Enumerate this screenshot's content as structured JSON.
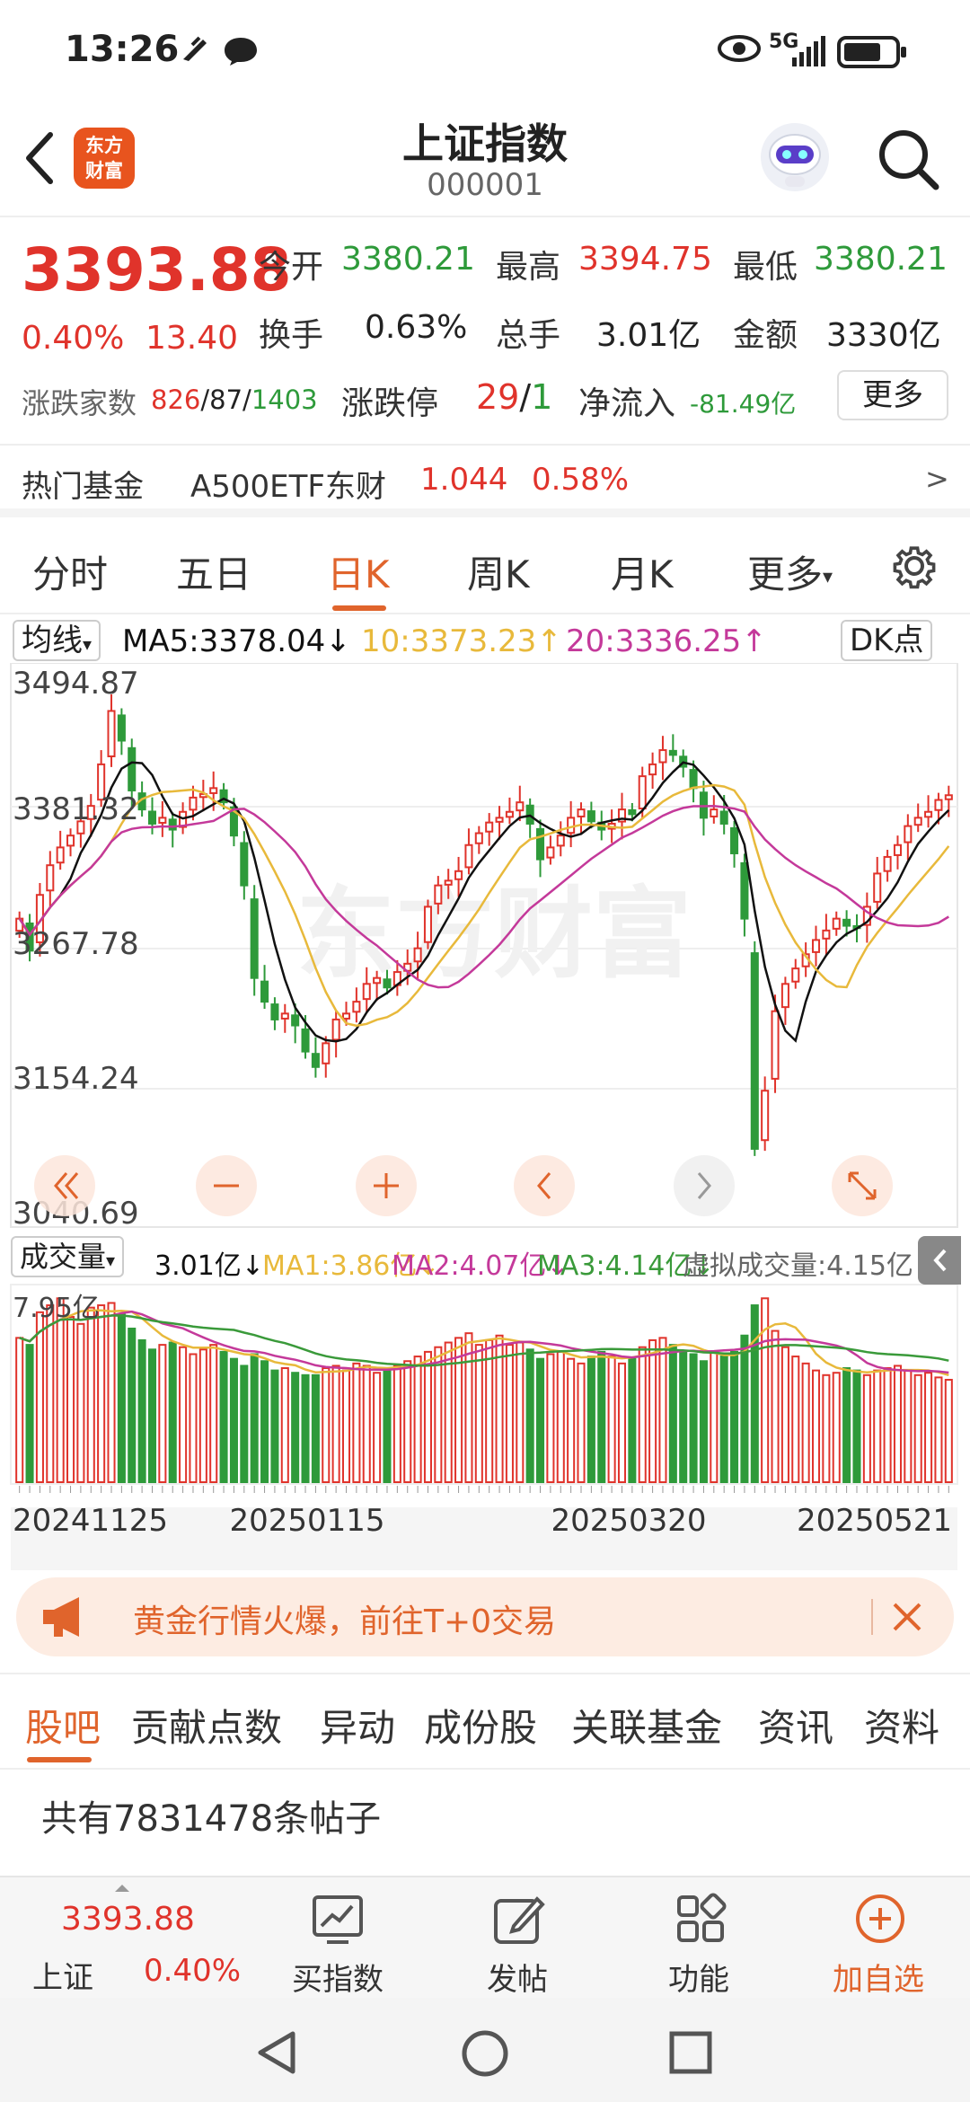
{
  "status_bar": {
    "time": "13:26",
    "network": "5G"
  },
  "header": {
    "title": "上证指数",
    "code": "000001",
    "logo_text_1": "东方",
    "logo_text_2": "财富"
  },
  "quote": {
    "price": "3393.88",
    "change_pct": "0.40%",
    "change_amt": "13.40",
    "open_label": "今开",
    "open": "3380.21",
    "high_label": "最高",
    "high": "3394.75",
    "low_label": "最低",
    "low": "3380.21",
    "turnover_label": "换手",
    "turnover": "0.63%",
    "hands_label": "总手",
    "hands": "3.01亿",
    "amount_label": "金额",
    "amount": "3330亿",
    "updown_label": "涨跌家数",
    "up_count": "826",
    "flat_count": "87",
    "down_count": "1403",
    "limit_label": "涨跌停",
    "limit_up": "29",
    "limit_down": "1",
    "netflow_label": "净流入",
    "netflow": "-81.49亿",
    "more_label": "更多"
  },
  "hot_fund": {
    "label": "热门基金",
    "name": "A500ETF东财",
    "price": "1.044",
    "change": "0.58%",
    "arrow": ">"
  },
  "period_tabs": [
    {
      "label": "分时",
      "active": false
    },
    {
      "label": "五日",
      "active": false
    },
    {
      "label": "日K",
      "active": true
    },
    {
      "label": "周K",
      "active": false
    },
    {
      "label": "月K",
      "active": false
    },
    {
      "label": "更多",
      "active": false
    }
  ],
  "ma_row": {
    "selector": "均线",
    "ma5": "MA5:3378.04",
    "ma10": "10:3373.23",
    "ma20": "20:3336.25",
    "dk_label": "DK点"
  },
  "vol_row": {
    "selector": "成交量",
    "vol": "3.01亿",
    "ma1": "MA1:3.86亿",
    "ma2": "MA2:4.07亿",
    "ma3": "MA3:4.14亿",
    "virtual": "虚拟成交量:4.15亿"
  },
  "colors": {
    "up": "#e0332b",
    "down": "#2e9a3a",
    "accent": "#e0642c",
    "ma5": "#111111",
    "ma10": "#e8b93b",
    "ma20": "#c4399a",
    "vol_ma3": "#3a9a3a"
  },
  "chart_data": {
    "type": "candlestick",
    "y_tick_labels": [
      "3494.87",
      "3381.32",
      "3267.78",
      "3154.24",
      "3040.69"
    ],
    "ylim": [
      3040.69,
      3494.87
    ],
    "x_tick_labels": [
      "20241125",
      "20250115",
      "20250320",
      "20250521"
    ],
    "volume_tick_label": "7.95亿",
    "volume_max": 7.95,
    "closes": [
      3290,
      3263,
      3310,
      3335,
      3350,
      3360,
      3372,
      3385,
      3420,
      3465,
      3440,
      3398,
      3382,
      3370,
      3375,
      3365,
      3380,
      3392,
      3395,
      3400,
      3388,
      3360,
      3318,
      3240,
      3220,
      3205,
      3210,
      3200,
      3178,
      3165,
      3185,
      3205,
      3210,
      3220,
      3235,
      3240,
      3232,
      3245,
      3252,
      3265,
      3300,
      3318,
      3322,
      3330,
      3352,
      3362,
      3371,
      3375,
      3380,
      3388,
      3370,
      3340,
      3350,
      3360,
      3375,
      3382,
      3372,
      3365,
      3370,
      3382,
      3378,
      3410,
      3420,
      3432,
      3428,
      3418,
      3400,
      3375,
      3382,
      3370,
      3345,
      3290,
      3096,
      3145,
      3212,
      3235,
      3248,
      3260,
      3272,
      3280,
      3290,
      3284,
      3282,
      3300,
      3328,
      3342,
      3352,
      3368,
      3375,
      3380,
      3390,
      3394
    ],
    "volumes": [
      6.2,
      5.9,
      7.3,
      7.6,
      7.9,
      7.1,
      6.8,
      7.5,
      7.6,
      7.7,
      7.2,
      6.6,
      6.1,
      5.7,
      5.9,
      6.0,
      5.8,
      5.5,
      5.7,
      5.9,
      5.6,
      5.3,
      5.0,
      5.5,
      5.2,
      4.8,
      4.9,
      4.7,
      4.6,
      4.6,
      4.9,
      5.0,
      4.8,
      5.1,
      5.0,
      4.7,
      4.9,
      5.0,
      5.2,
      5.4,
      5.6,
      5.8,
      6.0,
      6.2,
      6.4,
      5.9,
      6.1,
      6.3,
      5.9,
      6.0,
      5.7,
      5.3,
      5.5,
      5.6,
      5.3,
      5.1,
      5.4,
      5.6,
      5.4,
      5.1,
      5.3,
      5.8,
      6.1,
      6.2,
      5.9,
      5.6,
      5.5,
      5.2,
      5.6,
      5.4,
      5.6,
      6.3,
      7.6,
      7.9,
      6.5,
      5.8,
      5.4,
      5.1,
      4.8,
      4.6,
      4.7,
      4.9,
      4.8,
      4.6,
      4.8,
      4.9,
      5.0,
      4.8,
      4.6,
      4.7,
      4.5,
      4.4
    ],
    "volume_ma": [
      {
        "name": "MA1",
        "value": 3.86
      },
      {
        "name": "MA2",
        "value": 4.07
      },
      {
        "name": "MA3",
        "value": 4.14
      }
    ]
  },
  "banner": {
    "text": "黄金行情火爆，前往T+0交易"
  },
  "section_tabs": [
    {
      "label": "股吧",
      "active": true
    },
    {
      "label": "贡献点数",
      "active": false
    },
    {
      "label": "异动",
      "active": false
    },
    {
      "label": "成份股",
      "active": false
    },
    {
      "label": "关联基金",
      "active": false
    },
    {
      "label": "资讯",
      "active": false
    },
    {
      "label": "资料",
      "active": false
    }
  ],
  "post_count": "共有7831478条帖子",
  "bottom_bar": {
    "mini_price": "3393.88",
    "mini_name": "上证",
    "mini_pct": "0.40%",
    "buy_label": "买指数",
    "post_label": "发帖",
    "func_label": "功能",
    "watch_label": "加自选"
  }
}
